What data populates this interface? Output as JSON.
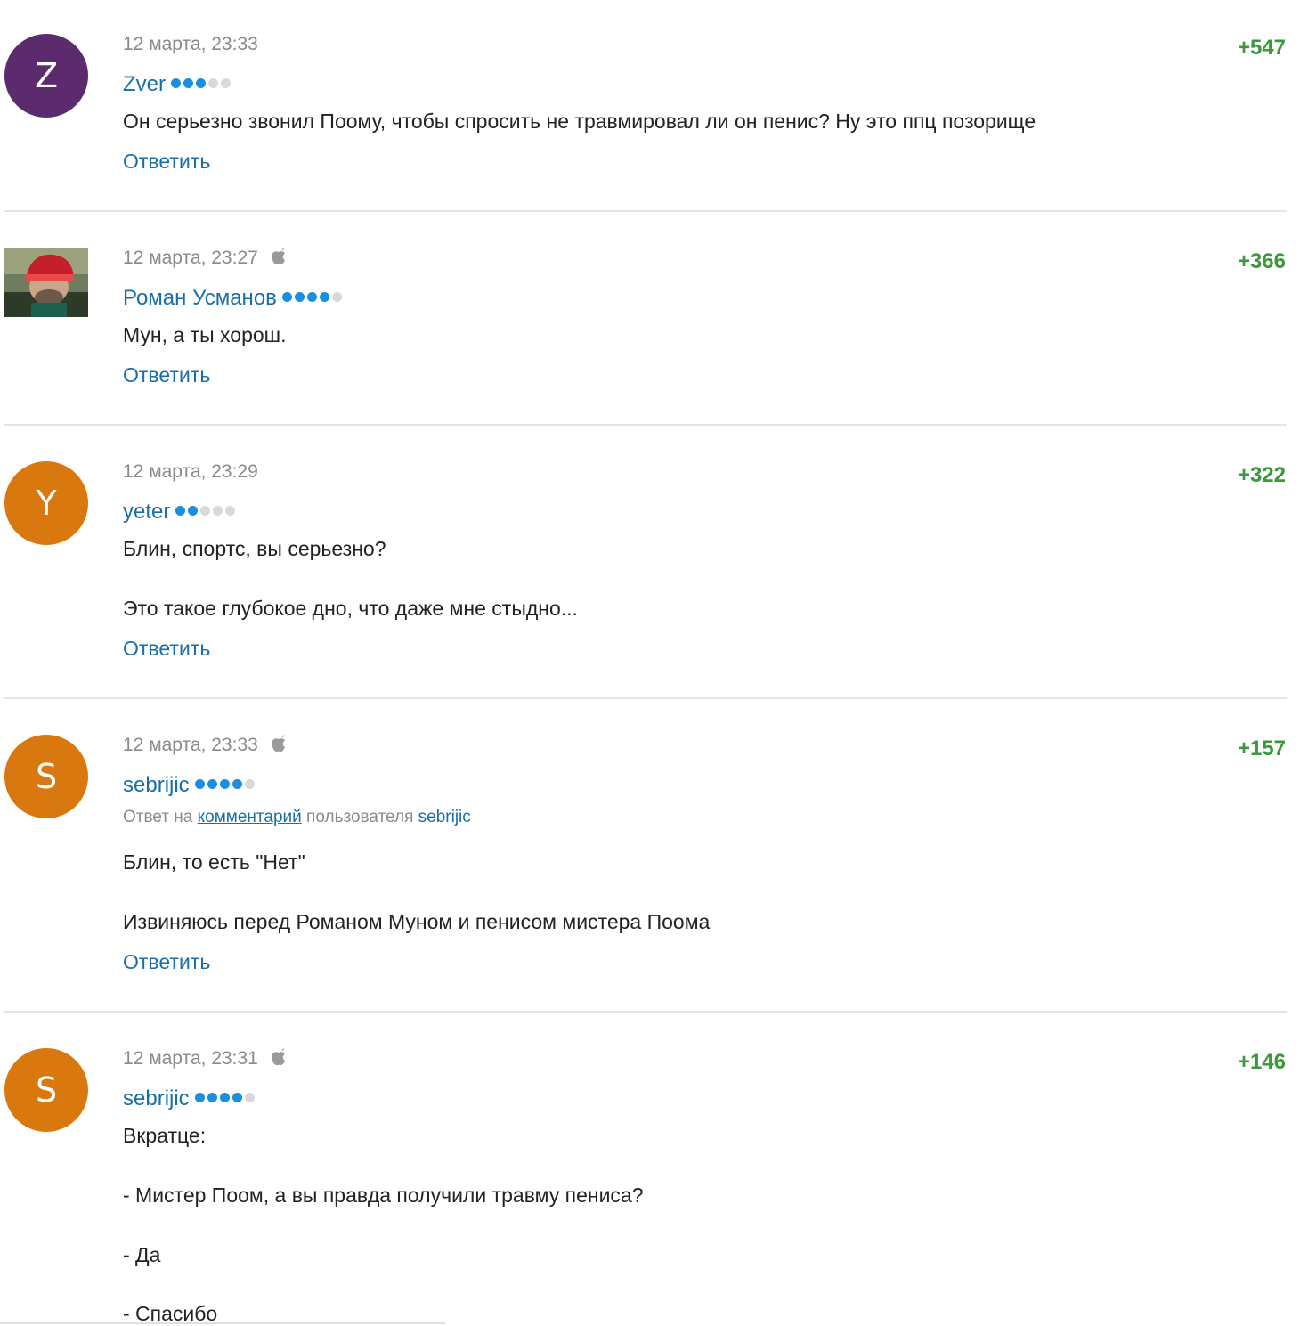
{
  "comments": [
    {
      "avatar_letter": "Z",
      "avatar_color": "#5b2b6e",
      "date": "12 марта, 23:33",
      "apple": false,
      "author": "Zver",
      "rating_dots": [
        true,
        true,
        true,
        false,
        false
      ],
      "score": "+547",
      "lines": [
        "Он серьезно звонил Поому, чтобы спросить не травмировал ли он пенис? Ну это ппц позорище"
      ],
      "reply_label": "Ответить"
    },
    {
      "avatar_letter": "",
      "avatar_color": "#2f4a2a",
      "date": "12 марта, 23:27",
      "apple": true,
      "author": "Роман Усманов",
      "rating_dots": [
        true,
        true,
        true,
        true,
        false
      ],
      "score": "+366",
      "lines": [
        "Мун, а ты хорош."
      ],
      "reply_label": "Ответить"
    },
    {
      "avatar_letter": "Y",
      "avatar_color": "#d8780f",
      "date": "12 марта, 23:29",
      "apple": false,
      "author": "yeter",
      "rating_dots": [
        true,
        true,
        false,
        false,
        false
      ],
      "score": "+322",
      "lines": [
        "Блин, спортс, вы серьезно?",
        "Это такое глубокое дно, что даже мне стыдно..."
      ],
      "reply_label": "Ответить"
    },
    {
      "avatar_letter": "S",
      "avatar_color": "#d8780f",
      "date": "12 марта, 23:33",
      "apple": true,
      "author": "sebrijic",
      "rating_dots": [
        true,
        true,
        true,
        true,
        false
      ],
      "score": "+157",
      "reply_to": {
        "prefix": "Ответ на",
        "link": "комментарий",
        "middle": "пользователя",
        "user": "sebrijic"
      },
      "lines": [
        "Блин, то есть \"Нет\"",
        "Извиняюсь перед Романом Муном и пенисом мистера Поома"
      ],
      "reply_label": "Ответить"
    },
    {
      "avatar_letter": "S",
      "avatar_color": "#d8780f",
      "date": "12 марта, 23:31",
      "apple": true,
      "author": "sebrijic",
      "rating_dots": [
        true,
        true,
        true,
        true,
        false
      ],
      "score": "+146",
      "lines": [
        "Вкратце:",
        "- Мистер Поом, а вы правда получили травму пениса?",
        "- Да",
        "- Спасибо"
      ]
    }
  ]
}
